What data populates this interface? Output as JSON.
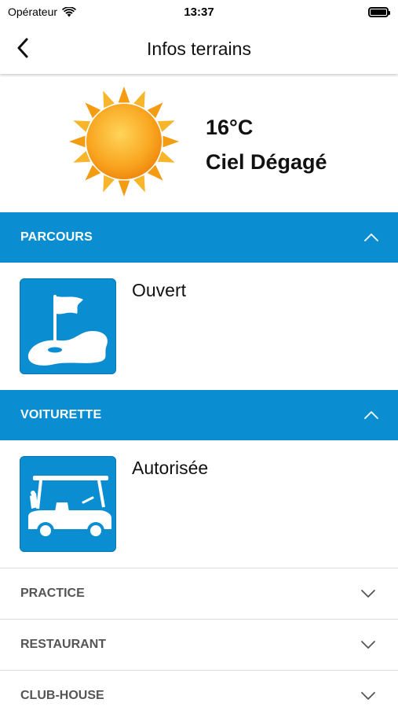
{
  "status_bar": {
    "carrier": "Opérateur",
    "time": "13:37"
  },
  "header": {
    "title": "Infos terrains"
  },
  "weather": {
    "temperature": "16°C",
    "condition": "Ciel Dégagé"
  },
  "sections": [
    {
      "title": "PARCOURS",
      "expanded": true,
      "status": "Ouvert",
      "icon": "golf-course-icon"
    },
    {
      "title": "VOITURETTE",
      "expanded": true,
      "status": "Autorisée",
      "icon": "golf-cart-icon"
    }
  ],
  "rows": [
    {
      "title": "PRACTICE",
      "expanded": false
    },
    {
      "title": "RESTAURANT",
      "expanded": false
    },
    {
      "title": "CLUB-HOUSE",
      "expanded": false
    }
  ],
  "colors": {
    "accent": "#0a8ed1",
    "row_text": "#555555",
    "sun": "#f7a81b"
  }
}
